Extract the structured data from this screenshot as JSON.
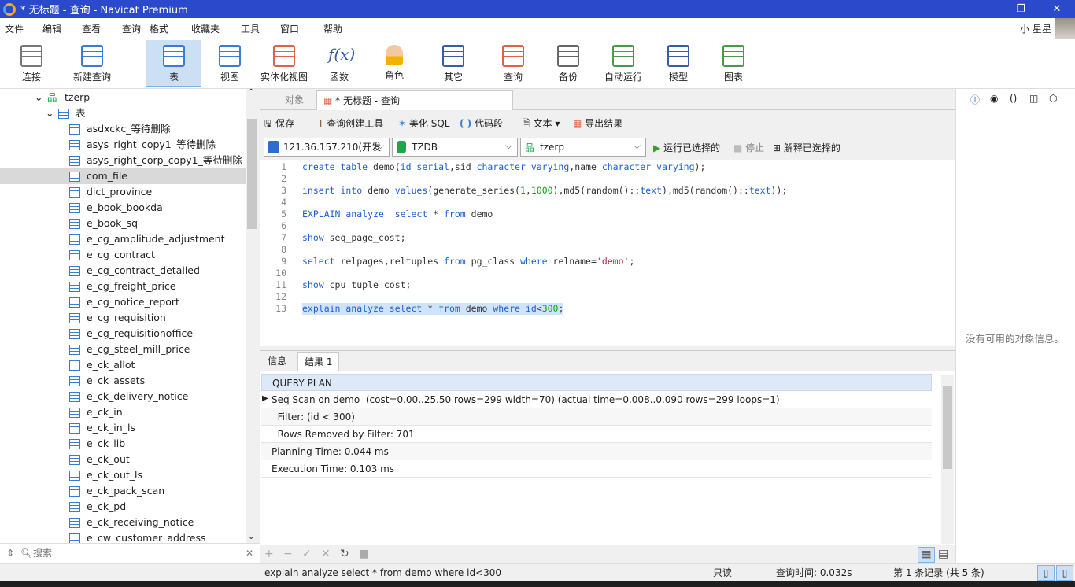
{
  "window": {
    "title": "* 无标题 - 查询 - Navicat Premium",
    "user": "小 星星"
  },
  "menu": [
    "文件",
    "编辑",
    "查看",
    "查询",
    "格式",
    "收藏夹",
    "工具",
    "窗口",
    "帮助"
  ],
  "toolbar": [
    {
      "label": "连接",
      "icon": "connect-icon",
      "color": "#777777"
    },
    {
      "label": "新建查询",
      "icon": "new-query-icon",
      "color": "#3a7bd5"
    },
    {
      "label": "表",
      "icon": "table-icon",
      "color": "#3a7bd5",
      "active": true
    },
    {
      "label": "视图",
      "icon": "view-icon",
      "color": "#3a7bd5"
    },
    {
      "label": "实体化视图",
      "icon": "materialized-view-icon",
      "color": "#e0624a"
    },
    {
      "label": "函数",
      "icon": "function-icon",
      "color": "#3a5ca8"
    },
    {
      "label": "角色",
      "icon": "role-icon",
      "color": "#f0b400"
    },
    {
      "label": "其它",
      "icon": "other-icon",
      "color": "#3a5ca8"
    },
    {
      "label": "查询",
      "icon": "query-icon",
      "color": "#e0624a"
    },
    {
      "label": "备份",
      "icon": "backup-icon",
      "color": "#666666"
    },
    {
      "label": "自动运行",
      "icon": "auto-run-icon",
      "color": "#4a9a4a"
    },
    {
      "label": "模型",
      "icon": "model-icon",
      "color": "#3a5ca8"
    },
    {
      "label": "图表",
      "icon": "chart-icon",
      "color": "#4a9a4a"
    }
  ],
  "tree": {
    "schema": "tzerp",
    "group": "表",
    "selected": "com_file",
    "items": [
      "asdxckc_等待删除",
      "asys_right_copy1_等待删除",
      "asys_right_corp_copy1_等待删除",
      "com_file",
      "dict_province",
      "e_book_bookda",
      "e_book_sq",
      "e_cg_amplitude_adjustment",
      "e_cg_contract",
      "e_cg_contract_detailed",
      "e_cg_freight_price",
      "e_cg_notice_report",
      "e_cg_requisition",
      "e_cg_requisitionoffice",
      "e_cg_steel_mill_price",
      "e_ck_allot",
      "e_ck_assets",
      "e_ck_delivery_notice",
      "e_ck_in",
      "e_ck_in_ls",
      "e_ck_lib",
      "e_ck_out",
      "e_ck_out_ls",
      "e_ck_pack_scan",
      "e_ck_pd",
      "e_ck_receiving_notice",
      "e_cw_customer_address"
    ]
  },
  "search": {
    "placeholder": "搜索"
  },
  "tabs": {
    "objects": "对象",
    "query": "* 无标题 - 查询"
  },
  "query_toolbar": {
    "save": "保存",
    "builder": "查询创建工具",
    "beautify": "美化 SQL",
    "snippet": "代码段",
    "text": "文本",
    "export": "导出结果"
  },
  "selectors": {
    "connection": "121.36.157.210(开发",
    "database": "TZDB",
    "schema": "tzerp",
    "run": "运行已选择的",
    "stop": "停止",
    "explain": "解释已选择的"
  },
  "editor": {
    "line_numbers": [
      "1",
      "2",
      "3",
      "4",
      "5",
      "6",
      "7",
      "8",
      "9",
      "10",
      "11",
      "12",
      "13"
    ],
    "lines": [
      [
        [
          "kw",
          "create table "
        ],
        [
          "",
          "demo("
        ],
        [
          "kw",
          "id serial"
        ],
        [
          "",
          ",sid "
        ],
        [
          "kw",
          "character varying"
        ],
        [
          "",
          ",name "
        ],
        [
          "kw",
          "character varying"
        ],
        [
          "",
          ");"
        ]
      ],
      [],
      [
        [
          "kw",
          "insert into "
        ],
        [
          "",
          "demo "
        ],
        [
          "kw",
          "values"
        ],
        [
          "",
          "(generate_series("
        ],
        [
          "num",
          "1"
        ],
        [
          "",
          ","
        ],
        [
          "num",
          "1000"
        ],
        [
          "",
          "),md5(random()::"
        ],
        [
          "kw",
          "text"
        ],
        [
          "",
          "),md5(random()::"
        ],
        [
          "kw",
          "text"
        ],
        [
          "",
          "));"
        ]
      ],
      [],
      [
        [
          "kw",
          "EXPLAIN analyze  select "
        ],
        [
          "",
          "* "
        ],
        [
          "kw",
          "from "
        ],
        [
          "",
          "demo"
        ]
      ],
      [],
      [
        [
          "kw",
          "show "
        ],
        [
          "",
          "seq_page_cost;"
        ]
      ],
      [],
      [
        [
          "kw",
          "select "
        ],
        [
          "",
          "relpages,reltuples "
        ],
        [
          "kw",
          "from "
        ],
        [
          "",
          "pg_class "
        ],
        [
          "kw",
          "where "
        ],
        [
          "",
          "relname="
        ],
        [
          "str",
          "'demo'"
        ],
        [
          "",
          ";"
        ]
      ],
      [],
      [
        [
          "kw",
          "show "
        ],
        [
          "",
          "cpu_tuple_cost;"
        ]
      ],
      [],
      [
        [
          "kw",
          "explain analyze select "
        ],
        [
          "",
          "* "
        ],
        [
          "kw",
          "from "
        ],
        [
          "",
          "demo "
        ],
        [
          "kw",
          "where "
        ],
        [
          "kw",
          "id"
        ],
        [
          "",
          "<"
        ],
        [
          "num",
          "300"
        ],
        [
          "",
          ";"
        ]
      ]
    ]
  },
  "result_tabs": {
    "info": "信息",
    "result": "结果 1"
  },
  "grid": {
    "header": "QUERY PLAN",
    "rows": [
      "Seq Scan on demo  (cost=0.00..25.50 rows=299 width=70) (actual time=0.008..0.090 rows=299 loops=1)",
      "  Filter: (id < 300)",
      "  Rows Removed by Filter: 701",
      "Planning Time: 0.044 ms",
      "Execution Time: 0.103 ms"
    ]
  },
  "right_panel": {
    "empty": "没有可用的对象信息。"
  },
  "status": {
    "sql": "explain analyze select * from demo where id<300",
    "mode": "只读",
    "time": "查询时间: 0.032s",
    "record": "第 1 条记录 (共 5 条)"
  }
}
